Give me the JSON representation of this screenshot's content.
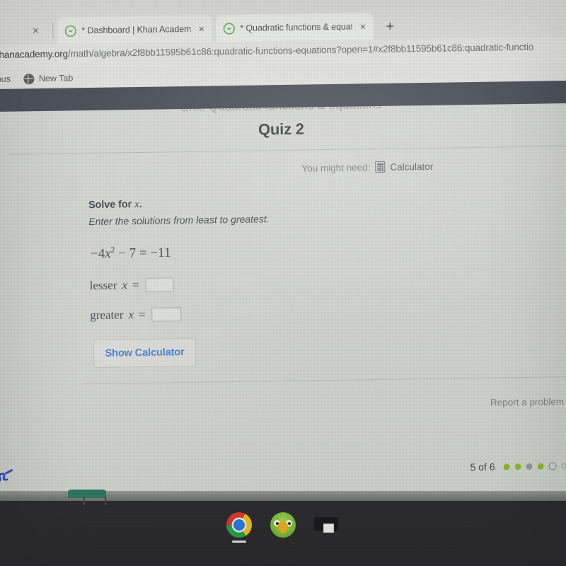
{
  "browser": {
    "tabs": [
      {
        "title": "* Dashboard | Khan Academy",
        "favicon": "khan-academy-leaf-icon",
        "close_label": "×"
      },
      {
        "title": "* Quadratic functions & equatio",
        "favicon": "khan-academy-leaf-icon",
        "close_label": "×"
      }
    ],
    "leftmost_tab_close_label": "×",
    "new_tab_label": "+",
    "url_host": "khanacademy.org",
    "url_path": "/math/algebra/x2f8bb11595b61c86:quadratic-functions-equations?open=1#x2f8bb11595b61c86:quadratic-functio",
    "bookmarks": [
      {
        "label": "mpus",
        "icon": ""
      },
      {
        "label": "New Tab",
        "icon": "globe-icon"
      }
    ]
  },
  "page": {
    "unit_title": "Unit: Quadratic functions & equations",
    "quiz_title": "Quiz 2",
    "back_label": "‹",
    "hint_prefix": "You might need:",
    "hint_tool": "Calculator",
    "prompt_line1_prefix": "Solve for ",
    "prompt_line1_var": "x",
    "prompt_line1_suffix": ".",
    "prompt_line2": "Enter the solutions from least to greatest.",
    "equation": {
      "lhs_coeff": "−4",
      "lhs_var": "x",
      "lhs_exp": "2",
      "lhs_term2": " − 7 ",
      "equals": "=",
      "rhs": " −11"
    },
    "answers": [
      {
        "label_prefix": "lesser ",
        "label_var": "x",
        "label_suffix": " =",
        "value": "",
        "placeholder": ""
      },
      {
        "label_prefix": "greater ",
        "label_var": "x",
        "label_suffix": " =",
        "value": "",
        "placeholder": ""
      }
    ],
    "show_calculator_label": "Show Calculator",
    "report_label": "Report a problem",
    "progress_label": "5 of 6",
    "progress_dots": [
      "correct",
      "correct",
      "skipped",
      "correct",
      "current",
      "upcoming"
    ],
    "pen_annotation": "℘"
  },
  "shelf": {
    "items": [
      {
        "name": "chrome-icon",
        "label": "Google Chrome",
        "active": true
      },
      {
        "name": "parrot-app-icon",
        "label": "Parrot App",
        "active": false
      },
      {
        "name": "printer-icon",
        "label": "Printer",
        "active": false
      }
    ]
  },
  "colors": {
    "accent_blue": "#3f7fd1",
    "progress_green": "#8fbf2e",
    "topbar_dark": "#474b55",
    "shelf_dark": "#2d2d2f"
  }
}
